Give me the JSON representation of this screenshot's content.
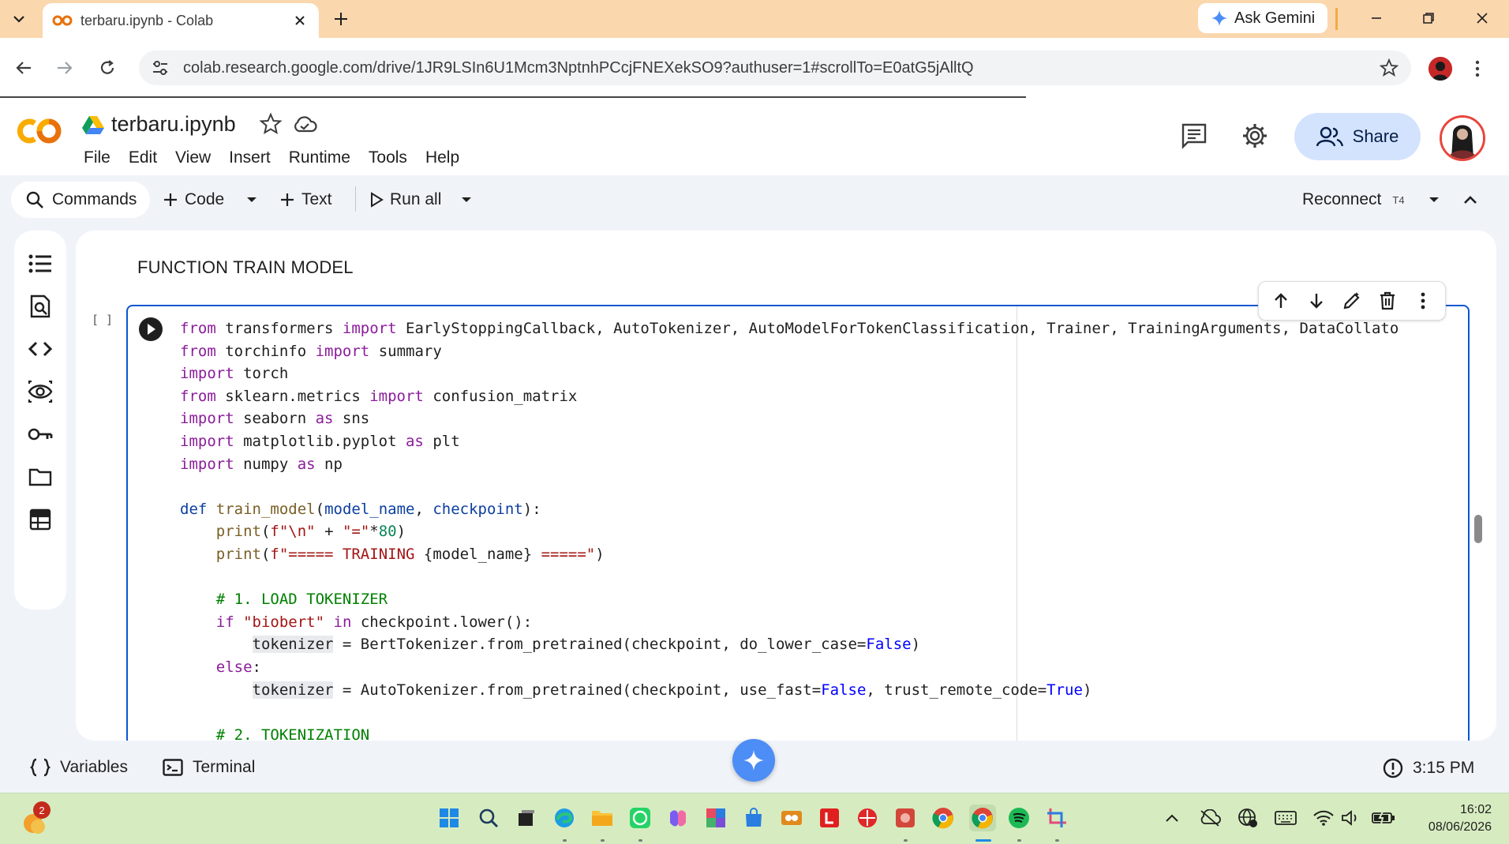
{
  "browser": {
    "tab_title": "terbaru.ipynb - Colab",
    "ask_gemini": "Ask Gemini",
    "url": "colab.research.google.com/drive/1JR9LSIn6U1Mcm3NptnhPCcjFNEXekSO9?authuser=1#scrollTo=E0atG5jAlltQ"
  },
  "colab": {
    "notebook_title": "terbaru.ipynb",
    "menu": [
      "File",
      "Edit",
      "View",
      "Insert",
      "Runtime",
      "Tools",
      "Help"
    ],
    "share_label": "Share"
  },
  "toolbar": {
    "commands": "Commands",
    "code": "Code",
    "text": "Text",
    "run_all": "Run all",
    "reconnect": "Reconnect",
    "runtime_type": "T4"
  },
  "notebook": {
    "text_cell": "FUNCTION TRAIN MODEL",
    "exec_count": "[ ]"
  },
  "statusbar": {
    "variables": "Variables",
    "terminal": "Terminal",
    "time": "3:15 PM"
  },
  "taskbar": {
    "notification_count": "2",
    "clock_time": "16:02",
    "clock_date": "08/06/2026"
  },
  "colors": {
    "tabstrip": "#fbd7ae",
    "accent": "#0b57d0",
    "share_bg": "#d3e3fd",
    "taskbar": "#d6ecc0"
  }
}
